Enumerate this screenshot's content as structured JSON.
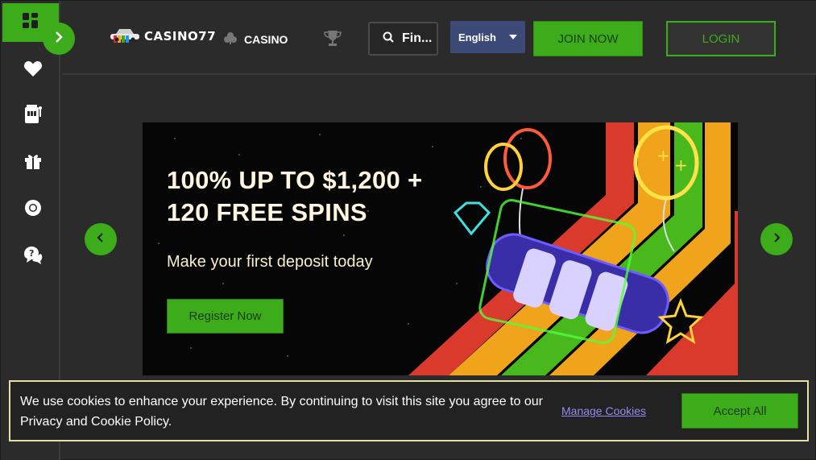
{
  "header": {
    "logo_text": "CASINO77",
    "nav_casino": "CASINO",
    "search_placeholder": "Fin...",
    "language": "English",
    "join_label": "JOIN NOW",
    "login_label": "LOGIN"
  },
  "sidebar": {
    "items": [
      {
        "icon": "grid-icon"
      },
      {
        "icon": "heart-icon"
      },
      {
        "icon": "slot-machine-icon"
      },
      {
        "icon": "gift-icon"
      },
      {
        "icon": "lifebuoy-icon"
      },
      {
        "icon": "chat-help-icon"
      }
    ]
  },
  "banner": {
    "title_line1": "100% UP TO $1,200 +",
    "title_line2": "120 FREE SPINS",
    "subtitle": "Make your first deposit today",
    "cta_label": "Register Now"
  },
  "cookie": {
    "text": "We use cookies to enhance your experience. By continuing to visit this site you agree to our Privacy and Cookie Policy.",
    "manage_label": "Manage Cookies",
    "accept_label": "Accept All"
  },
  "colors": {
    "accent": "#3cac1a",
    "background": "#2b2b2b",
    "language_bg": "#3c4a78"
  }
}
